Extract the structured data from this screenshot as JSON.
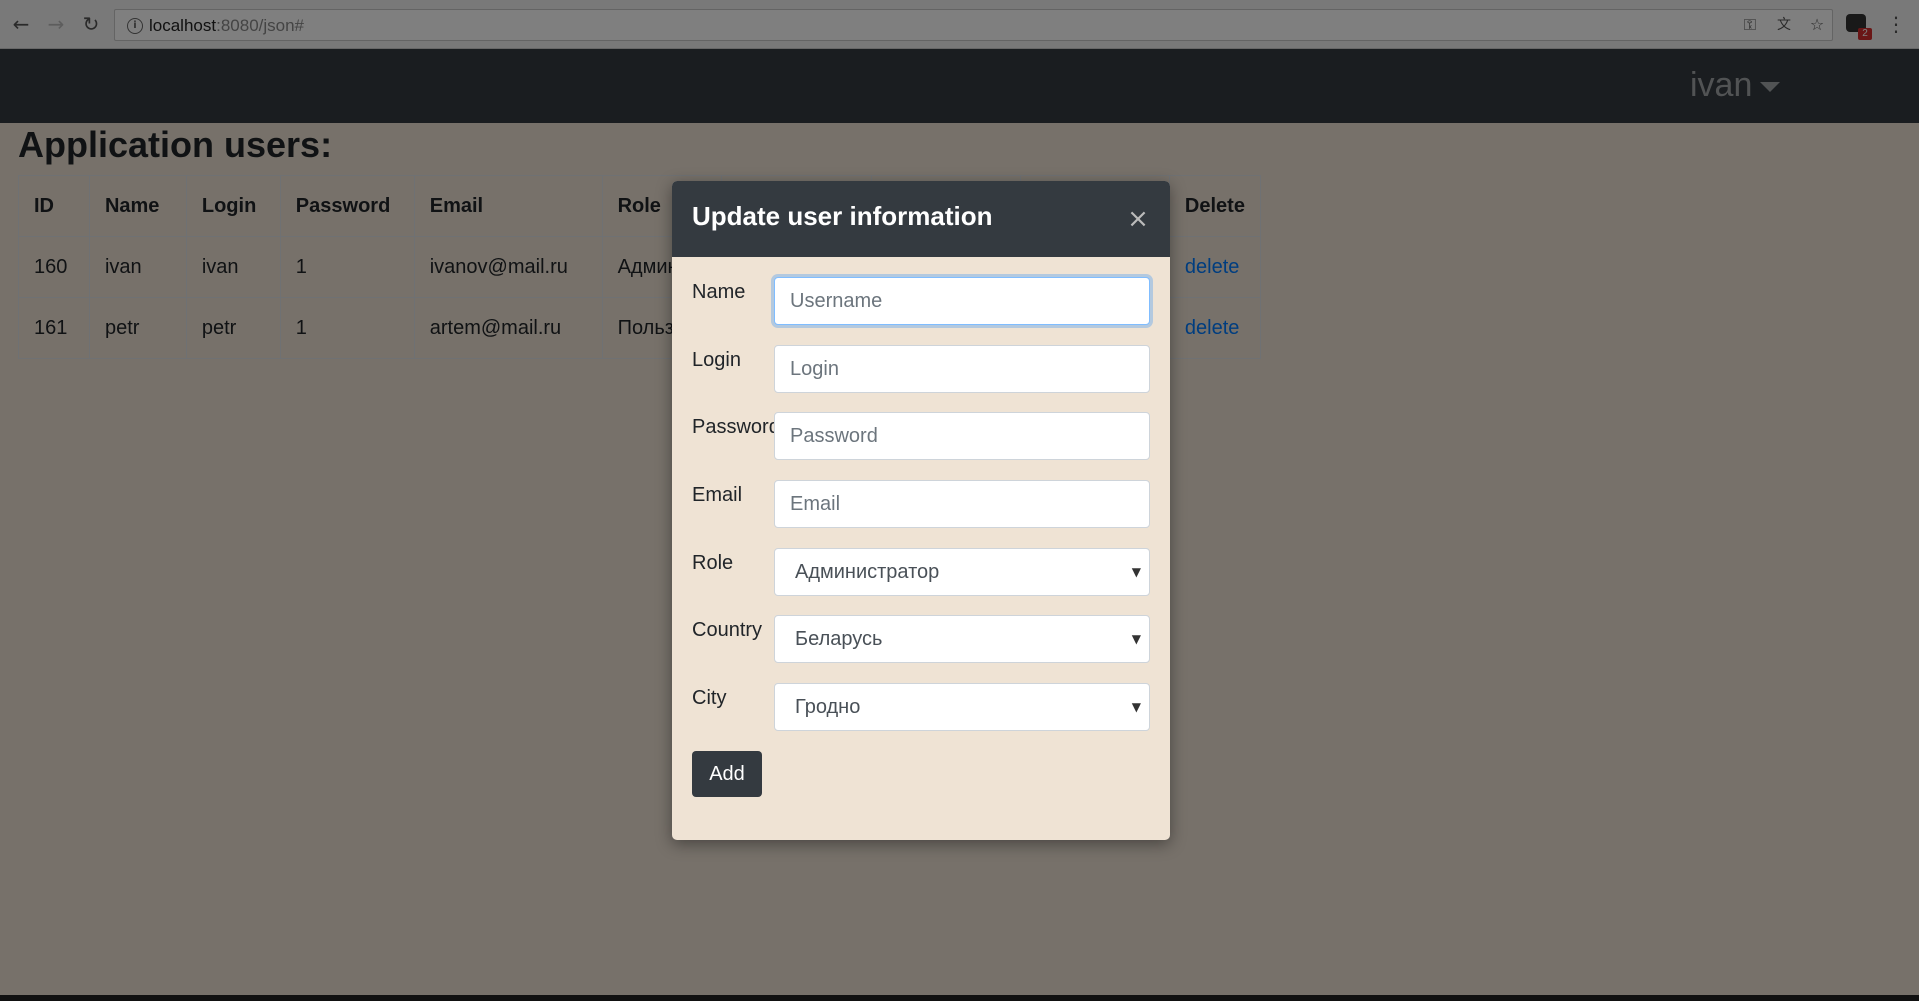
{
  "browser": {
    "url_host": "localhost",
    "url_rest": ":8080/json#",
    "extension_badge": "2"
  },
  "navbar": {
    "user": "ivan"
  },
  "page": {
    "title": "Application users:"
  },
  "table": {
    "headers": [
      "ID",
      "Name",
      "Login",
      "Password",
      "Email",
      "Role",
      "",
      "",
      "",
      "Delete"
    ],
    "rows": [
      {
        "id": "160",
        "name": "ivan",
        "login": "ivan",
        "password": "1",
        "email": "ivanov@mail.ru",
        "role": "Админ",
        "delete": "delete"
      },
      {
        "id": "161",
        "name": "petr",
        "login": "petr",
        "password": "1",
        "email": "artem@mail.ru",
        "role": "Польз",
        "delete": "delete"
      }
    ]
  },
  "modal": {
    "title": "Update user information",
    "close_symbol": "×",
    "fields": {
      "name": {
        "label": "Name",
        "placeholder": "Username"
      },
      "login": {
        "label": "Login",
        "placeholder": "Login"
      },
      "password": {
        "label": "Password",
        "placeholder": "Password"
      },
      "email": {
        "label": "Email",
        "placeholder": "Email"
      },
      "role": {
        "label": "Role",
        "value": "Администратор"
      },
      "country": {
        "label": "Country",
        "value": "Беларусь"
      },
      "city": {
        "label": "City",
        "value": "Гродно"
      }
    },
    "submit_label": "Add"
  },
  "colors": {
    "navbar": "#343a40",
    "link": "#007bff",
    "modal_bg": "#efe3d4"
  }
}
